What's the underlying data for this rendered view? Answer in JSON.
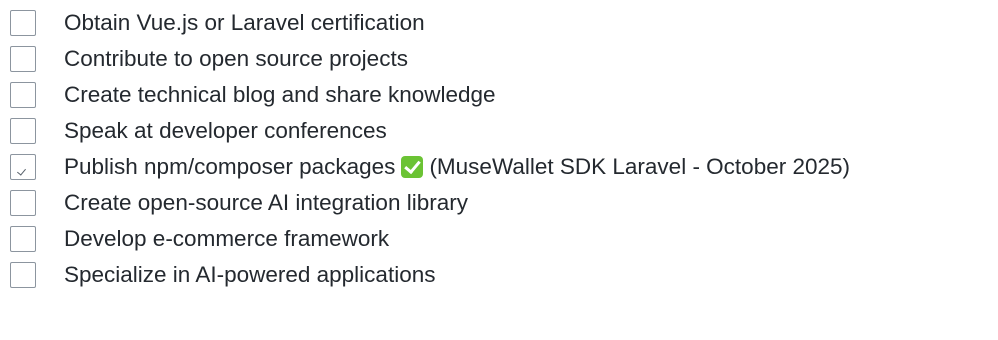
{
  "tasks": [
    {
      "label": "Obtain Vue.js or Laravel certification",
      "checked": false
    },
    {
      "label": "Contribute to open source projects",
      "checked": false
    },
    {
      "label": "Create technical blog and share knowledge",
      "checked": false
    },
    {
      "label": "Speak at developer conferences",
      "checked": false
    },
    {
      "label": "Publish npm/composer packages",
      "checked": true,
      "badge_icon": "white-check-mark-emoji-icon",
      "suffix": "(MuseWallet SDK Laravel - October 2025)"
    },
    {
      "label": "Create open-source AI integration library",
      "checked": false
    },
    {
      "label": "Develop e-commerce framework",
      "checked": false
    },
    {
      "label": "Specialize in AI-powered applications",
      "checked": false
    }
  ],
  "colors": {
    "text": "#24292f",
    "checkbox_border": "#8c959f",
    "emoji_green": "#6bc334"
  }
}
